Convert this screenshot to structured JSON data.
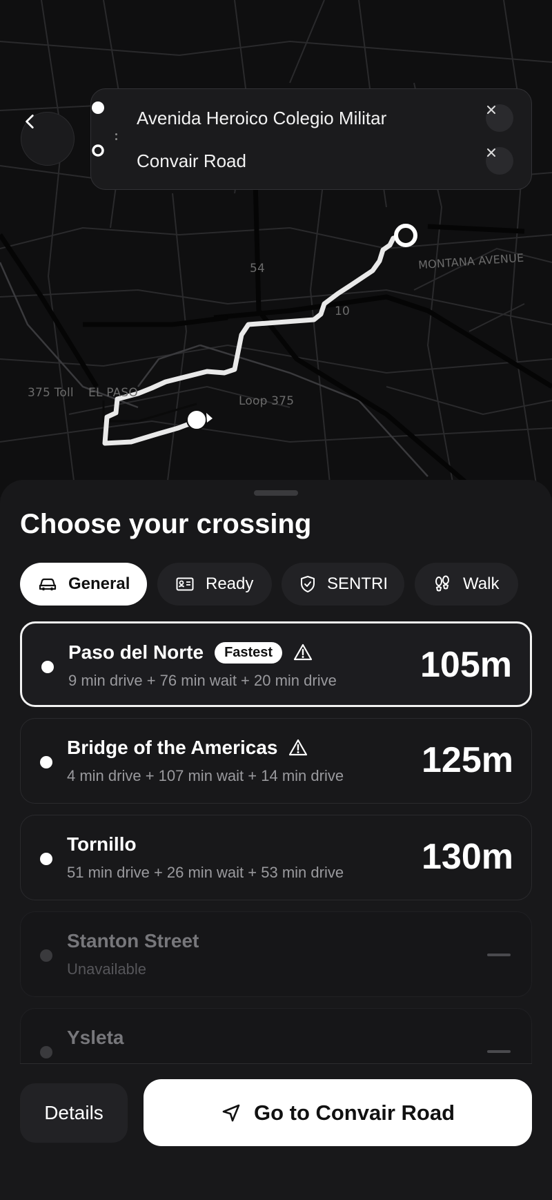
{
  "map": {
    "labels": {
      "highway_54": "54",
      "highway_10": "10",
      "montana": "MONTANA AVENUE",
      "toll": "375 Toll",
      "el_paso": "EL PASO",
      "loop": "Loop 375"
    }
  },
  "route": {
    "origin": "Avenida Heroico Colegio Militar",
    "destination": "Convair Road"
  },
  "sheet": {
    "title": "Choose your crossing",
    "tabs": [
      {
        "label": "General",
        "icon": "car-icon",
        "active": true
      },
      {
        "label": "Ready",
        "icon": "id-card-icon",
        "active": false
      },
      {
        "label": "SENTRI",
        "icon": "shield-check-icon",
        "active": false
      },
      {
        "label": "Walk",
        "icon": "footprints-icon",
        "active": false
      }
    ],
    "crossings": [
      {
        "name": "Paso del Norte",
        "badge": "Fastest",
        "warning": true,
        "detail": "9 min drive + 76 min wait + 20 min drive",
        "time": "105m",
        "selected": true
      },
      {
        "name": "Bridge of the Americas",
        "warning": true,
        "detail": "4 min drive + 107 min wait + 14 min drive",
        "time": "125m"
      },
      {
        "name": "Tornillo",
        "detail": "51 min drive + 26 min wait + 53 min drive",
        "time": "130m"
      },
      {
        "name": "Stanton Street",
        "detail": "Unavailable",
        "disabled": true
      },
      {
        "name": "Ysleta",
        "disabled": true
      }
    ]
  },
  "actions": {
    "details": "Details",
    "go": "Go to Convair Road"
  },
  "colors": {
    "background": "#111113",
    "sheet": "#18181a",
    "accent": "#ffffff",
    "muted_text": "#9a9a9e"
  }
}
